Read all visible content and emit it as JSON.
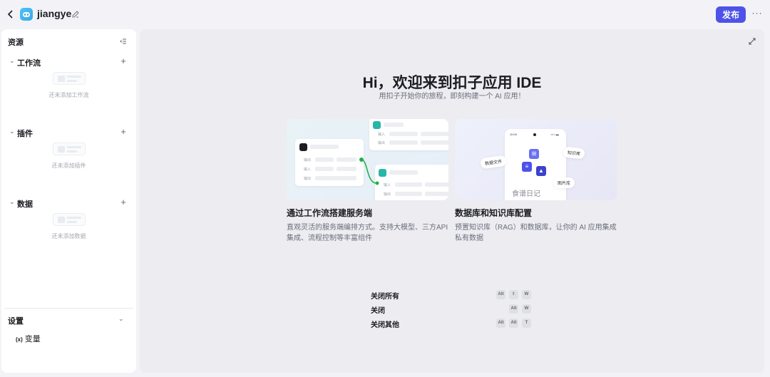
{
  "topbar": {
    "app_name": "jiangye",
    "publish_label": "发布",
    "more_label": "···"
  },
  "sidebar": {
    "header": "资源",
    "sections": [
      {
        "title": "工作流",
        "empty_text": "还未添加工作流"
      },
      {
        "title": "插件",
        "empty_text": "还未添加插件"
      },
      {
        "title": "数据",
        "empty_text": "还未添加数据"
      }
    ],
    "settings": {
      "title": "设置",
      "items": [
        {
          "prefix": "(x)",
          "label": "变量"
        }
      ]
    }
  },
  "main": {
    "title": "Hi，欢迎来到扣子应用 IDE",
    "subtitle": "用扣子开始你的旅程，即刻构建一个 AI 应用！",
    "cards": [
      {
        "title": "通过工作流搭建服务端",
        "description": "直观灵活的服务端编排方式。支持大模型、三方API集成、流程控制等丰富组件",
        "illustration": {
          "labels": [
            "输入",
            "输出",
            "输出",
            "输入",
            "输出",
            "输入",
            "输出"
          ]
        }
      },
      {
        "title": "数据库和知识库配置",
        "description": "预置知识库（RAG）和数据库，让你的 AI 应用集成私有数据",
        "illustration": {
          "phone_time": "10:09",
          "phone_status": "·ıl ≈ ▬",
          "tags": [
            "知识库",
            "数据文件",
            "图片库"
          ],
          "caption": "食谱日记"
        }
      }
    ],
    "shortcuts": [
      {
        "label": "关闭所有",
        "keys": [
          "Alt",
          "⇧",
          "W"
        ]
      },
      {
        "label": "关闭",
        "keys": [
          "Alt",
          "W"
        ]
      },
      {
        "label": "关闭其他",
        "keys": [
          "Alt",
          "Alt",
          "T"
        ]
      }
    ]
  },
  "colors": {
    "accent": "#4d53e8",
    "node_accent": "#29b6a8",
    "connector": "#22b14c"
  }
}
